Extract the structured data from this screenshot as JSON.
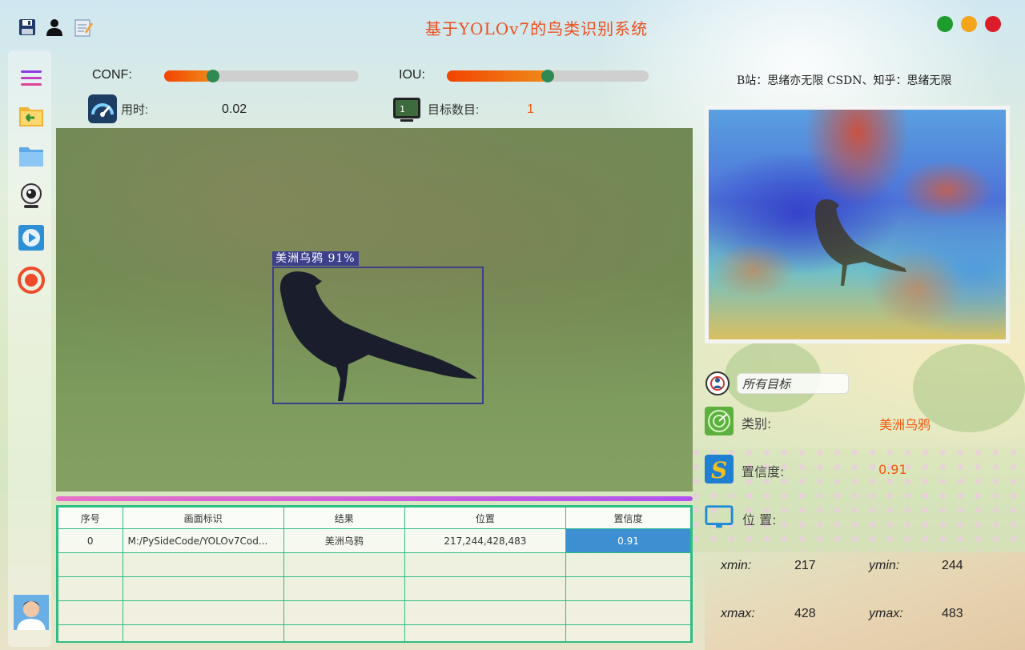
{
  "app": {
    "title": "基于YOLOv7的鸟类识别系统"
  },
  "controls": {
    "conf_label": "CONF:",
    "conf_value": 0.25,
    "iou_label": "IOU:",
    "iou_value": 0.5,
    "time_label": "用时:",
    "time_value": "0.02",
    "count_label": "目标数目:",
    "count_value": "1"
  },
  "credit": "B站：思绪亦无限  CSDN、知乎：思绪无限",
  "detection": {
    "label": "美洲乌鸦  91%"
  },
  "table": {
    "headers": [
      "序号",
      "画面标识",
      "结果",
      "位置",
      "置信度"
    ],
    "rows": [
      [
        "0",
        "M:/PySideCode/YOLOv7Cod...",
        "美洲乌鸦",
        "217,244,428,483",
        "0.91"
      ]
    ]
  },
  "result": {
    "target_select": "所有目标",
    "class_label": "类别:",
    "class_value": "美洲乌鸦",
    "conf_label": "置信度:",
    "conf_value": "0.91",
    "pos_label": "位  置:",
    "xmin_label": "xmin:",
    "xmin": "217",
    "ymin_label": "ymin:",
    "ymin": "244",
    "xmax_label": "xmax:",
    "xmax": "428",
    "ymax_label": "ymax:",
    "ymax": "483"
  },
  "icons": {
    "top": [
      "save-icon",
      "user-icon",
      "notepad-icon"
    ],
    "side": [
      "menu-icon",
      "open-folder-icon",
      "folder-icon",
      "webcam-icon",
      "video-play-icon",
      "stop-icon",
      "avatar"
    ],
    "window": [
      "maximize",
      "minimize",
      "close"
    ]
  },
  "colors": {
    "title": "#ee4e1c",
    "accent_value": "#f25a10",
    "table_border": "#2ebd85",
    "selected_row": "#3e8fd2"
  }
}
